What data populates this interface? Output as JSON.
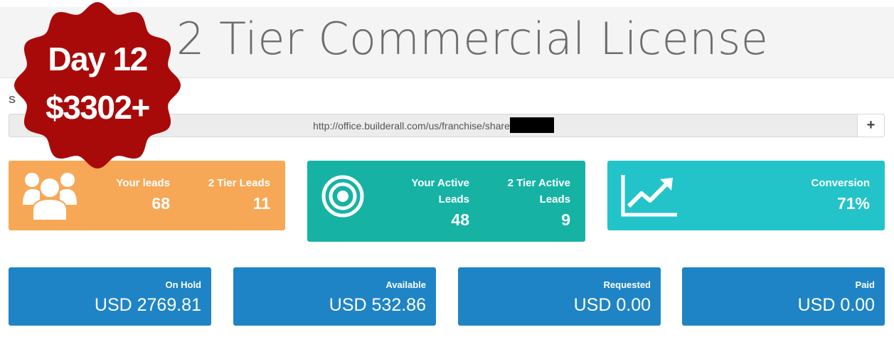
{
  "header": {
    "title": "2 Tier Commercial License"
  },
  "share": {
    "label": "S",
    "url": "http://office.builderall.com/us/franchise/share",
    "add_label": "+"
  },
  "badge": {
    "day": "Day 12",
    "amount": "$3302+",
    "color": "#a80a0a"
  },
  "leads_card": {
    "icon": "users-group-icon",
    "your_leads_label": "Your leads",
    "your_leads_value": "68",
    "tier_leads_label": "2 Tier Leads",
    "tier_leads_value": "11",
    "color": "#f7a856"
  },
  "active_card": {
    "icon": "target-icon",
    "your_active_label_1": "Your Active",
    "your_active_label_2": "Leads",
    "your_active_value": "48",
    "tier_active_label_1": "2 Tier Active",
    "tier_active_label_2": "Leads",
    "tier_active_value": "9",
    "color": "#16b3a5"
  },
  "conversion_card": {
    "icon": "line-chart-icon",
    "label": "Conversion",
    "value": "71%",
    "color": "#22c4c9"
  },
  "money": [
    {
      "label": "On Hold",
      "amount": "USD 2769.81"
    },
    {
      "label": "Available",
      "amount": "USD 532.86"
    },
    {
      "label": "Requested",
      "amount": "USD 0.00"
    },
    {
      "label": "Paid",
      "amount": "USD 0.00"
    }
  ],
  "money_color": "#1f84c6"
}
